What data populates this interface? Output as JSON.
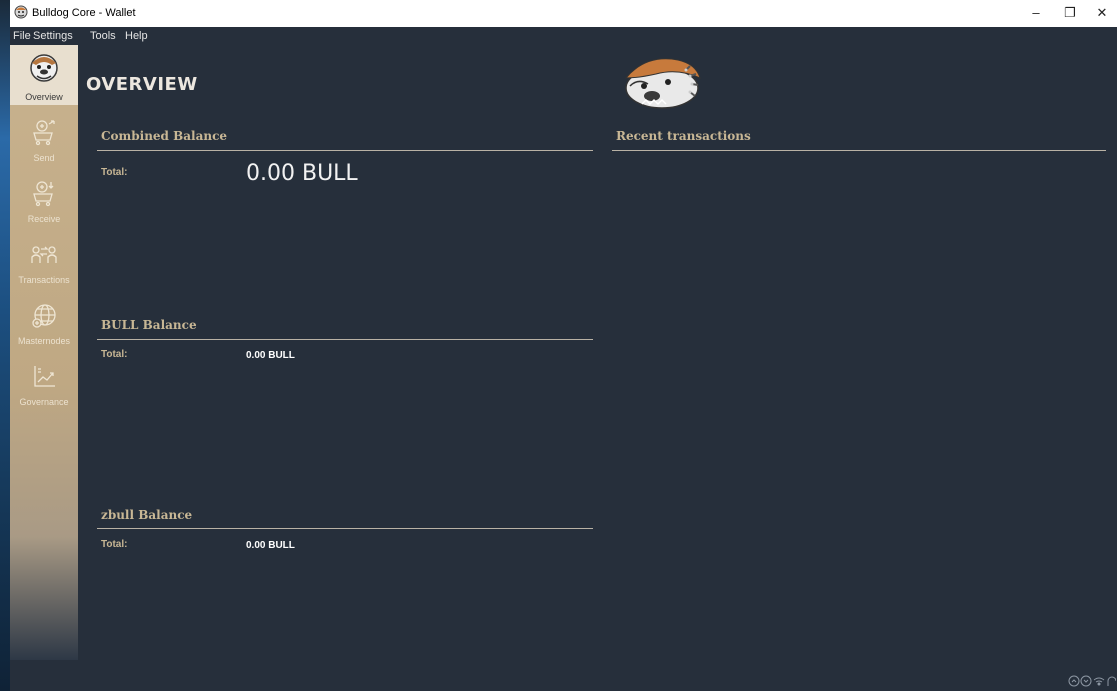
{
  "window": {
    "title": "Bulldog Core - Wallet",
    "minimize": "–",
    "restore": "❐",
    "close": "✕"
  },
  "menu": [
    "File",
    "Settings",
    "Tools",
    "Help"
  ],
  "sidebar": [
    {
      "label": "Overview",
      "icon": "bulldog-icon",
      "active": true
    },
    {
      "label": "Send",
      "icon": "send-cart-icon"
    },
    {
      "label": "Receive",
      "icon": "receive-cart-icon"
    },
    {
      "label": "Transactions",
      "icon": "transactions-icon"
    },
    {
      "label": "Masternodes",
      "icon": "globe-icon"
    },
    {
      "label": "Governance",
      "icon": "chart-icon"
    }
  ],
  "overview": {
    "title": "OVERVIEW",
    "combined": {
      "heading": "Combined Balance",
      "label": "Total:",
      "value": "0.00 BULL"
    },
    "bull": {
      "heading": "BULL Balance",
      "label": "Total:",
      "value": "0.00 BULL"
    },
    "zbull": {
      "heading": "zbull Balance",
      "label": "Total:",
      "value": "0.00 BULL"
    },
    "recent": {
      "heading": "Recent transactions"
    }
  },
  "colors": {
    "background": "#262f3b",
    "accent": "#c8b795",
    "sidebar": "#c8b28e"
  }
}
